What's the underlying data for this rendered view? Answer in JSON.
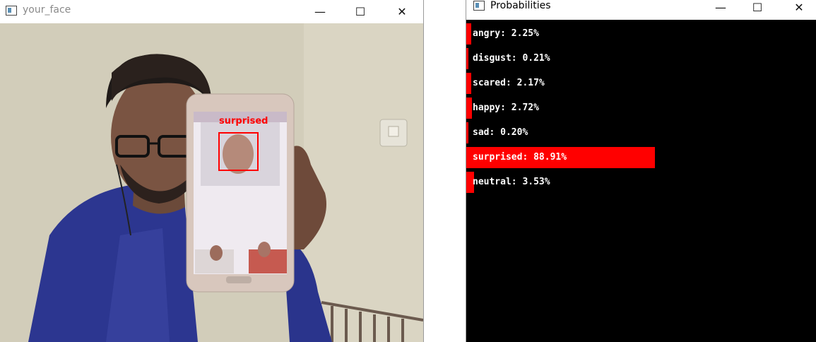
{
  "face_window": {
    "title": "your_face",
    "detection_label": "surprised"
  },
  "prob_window": {
    "title": "Probabilities",
    "items": [
      {
        "text": "angry: 2.25%",
        "value": 0.0225
      },
      {
        "text": "disgust: 0.21%",
        "value": 0.0021
      },
      {
        "text": "scared: 2.17%",
        "value": 0.0217
      },
      {
        "text": "happy: 2.72%",
        "value": 0.0272
      },
      {
        "text": "sad: 0.20%",
        "value": 0.002
      },
      {
        "text": "surprised: 88.91%",
        "value": 0.8891
      },
      {
        "text": "neutral: 3.53%",
        "value": 0.0353
      }
    ]
  },
  "controls": {
    "minimize": "—",
    "maximize": "☐",
    "close": "✕"
  },
  "colors": {
    "bar": "#ff0000",
    "detection_box": "#ff0000",
    "canvas_bg": "#000000"
  }
}
